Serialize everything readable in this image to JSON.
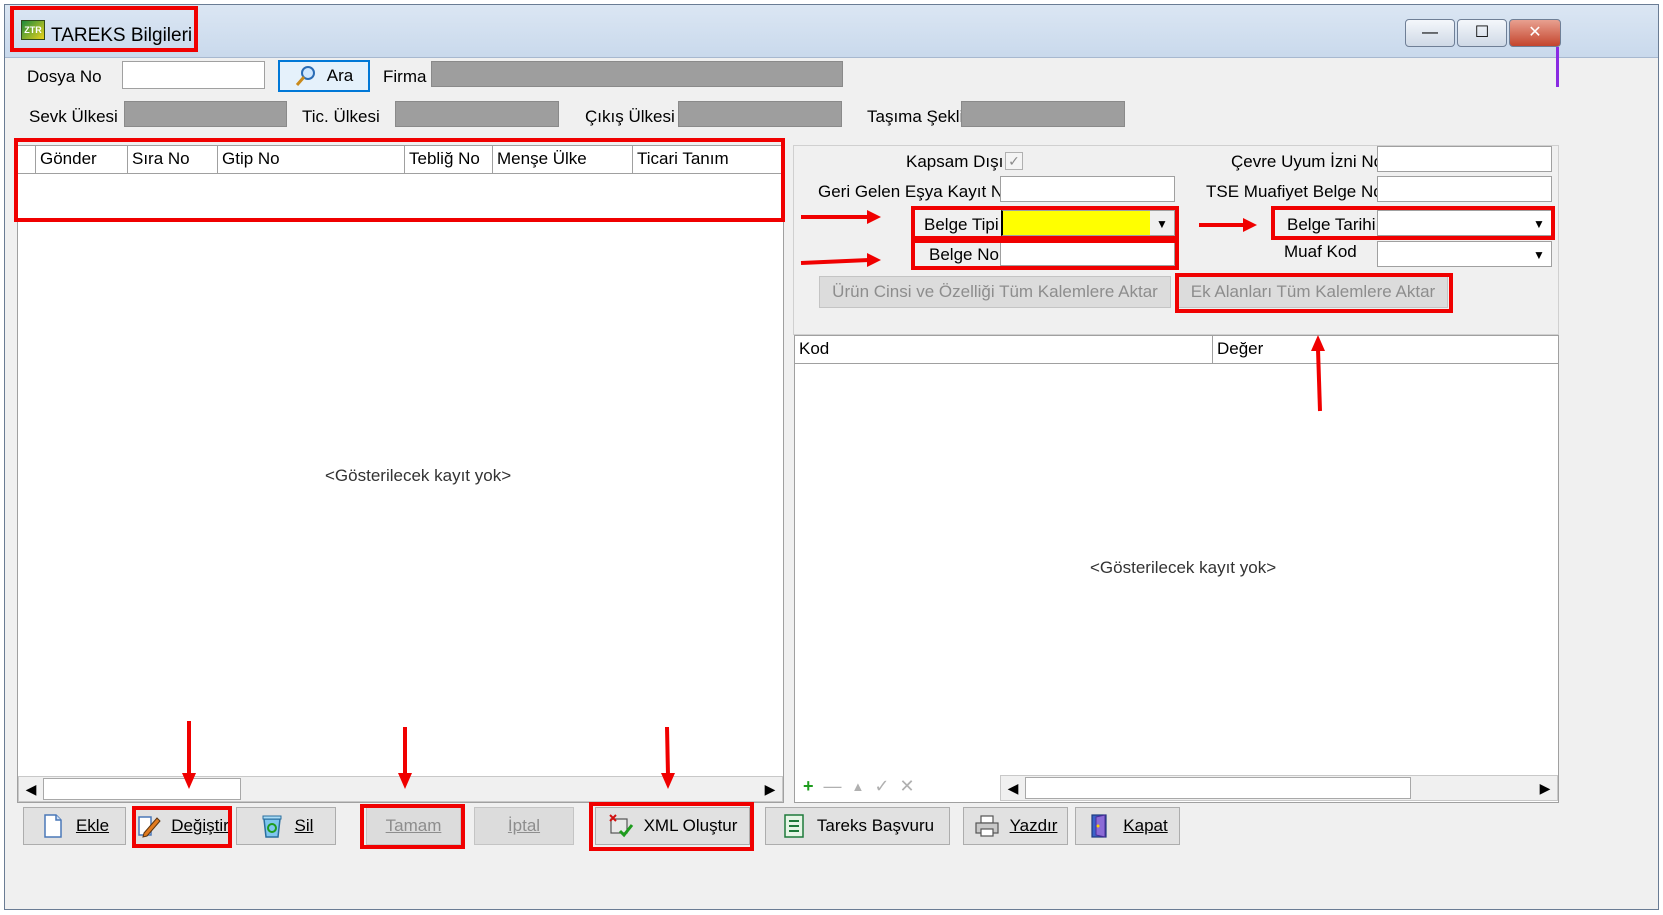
{
  "window": {
    "title": "TAREKS Bilgileri",
    "min_symbol": "—",
    "max_symbol": "☐",
    "close_symbol": "✕"
  },
  "header": {
    "dosya_no_label": "Dosya No",
    "dosya_no_value": "",
    "ara_label": "Ara",
    "firma_label": "Firma",
    "sevk_ulkesi_label": "Sevk Ülkesi",
    "tic_ulkesi_label": "Tic. Ülkesi",
    "cikis_ulkesi_label": "Çıkış Ülkesi",
    "tasima_sekli_label": "Taşıma Şekli"
  },
  "left_grid": {
    "columns": [
      "Gönder",
      "Sıra No",
      "Gtip No",
      "Tebliğ No",
      "Menşe Ülke",
      "Ticari Tanım"
    ],
    "empty_text": "<Gösterilecek kayıt yok>"
  },
  "right_form": {
    "kapsam_disi_label": "Kapsam Dışı",
    "kapsam_disi_checked": "✓",
    "cevre_uyum_label": "Çevre Uyum İzni No",
    "geri_gelen_label": "Geri Gelen Eşya Kayıt No",
    "tse_muafiyet_label": "TSE Muafiyet Belge No",
    "belge_tipi_label": "Belge Tipi",
    "belge_tarihi_label": "Belge Tarihi",
    "belge_no_label": "Belge No",
    "muaf_kod_label": "Muaf Kod",
    "urun_cinsi_button": "Ürün Cinsi ve Özelliği Tüm Kalemlere Aktar",
    "ek_alanlari_button": "Ek Alanları Tüm Kalemlere Aktar",
    "combo_arrow": "▼"
  },
  "right_grid": {
    "columns": [
      "Kod",
      "Değer"
    ],
    "empty_text": "<Gösterilecek kayıt yok>"
  },
  "scroll": {
    "left_arrow": "◀",
    "right_arrow": "▶"
  },
  "mini_tools": {
    "add": "+",
    "remove": "—",
    "up": "▲",
    "ok": "✓",
    "cancel": "✕"
  },
  "toolbar": {
    "ekle": "Ekle",
    "degistir": "Değiştir",
    "sil": "Sil",
    "tamam": "Tamam",
    "iptal": "İptal",
    "xml_olustur": "XML Oluştur",
    "tareks_basvuru": "Tareks Başvuru",
    "yazdir": "Yazdır",
    "kapat": "Kapat"
  },
  "colors": {
    "highlight_red": "#f00000",
    "belge_tipi_fill": "#ffff00",
    "disabled_field": "#9e9e9e",
    "window_bg": "#f0f0f0"
  }
}
